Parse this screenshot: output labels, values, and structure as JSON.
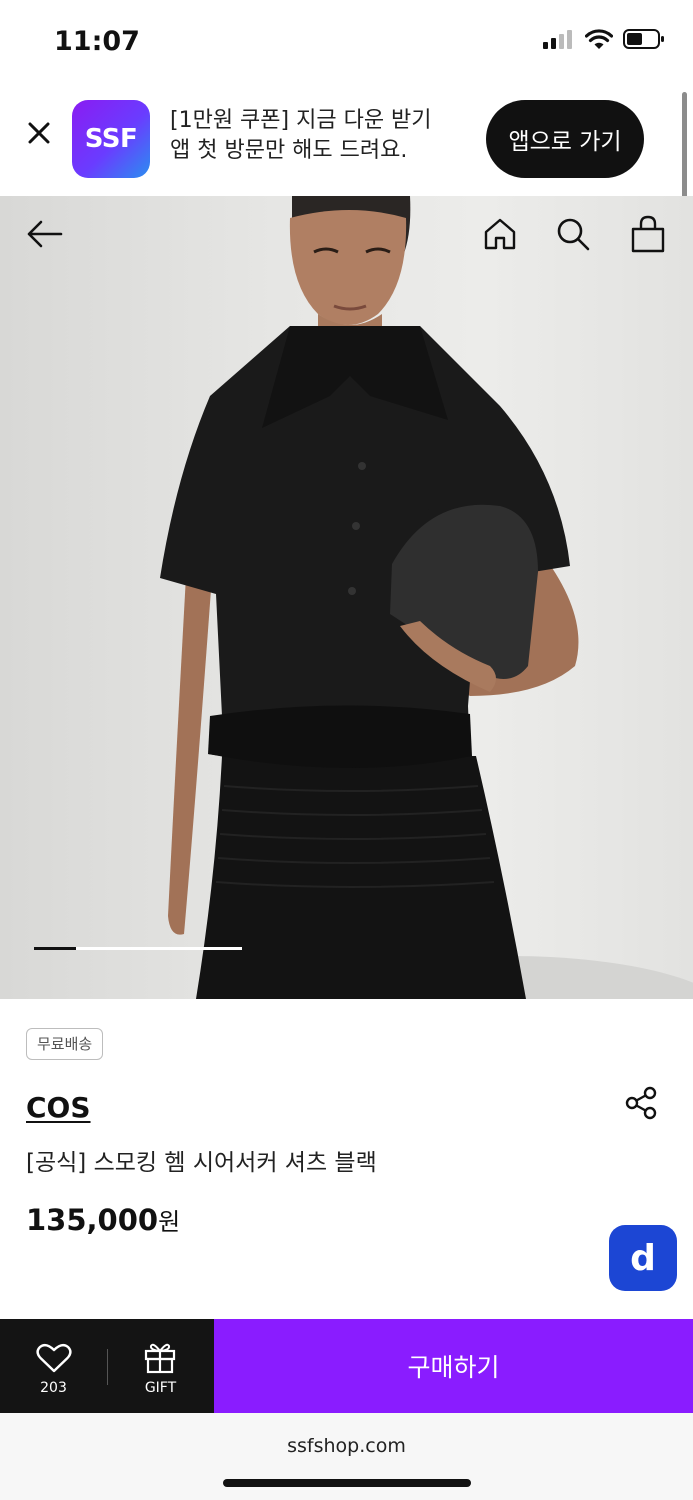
{
  "status_bar": {
    "time": "11:07"
  },
  "app_banner": {
    "logo_text": "SSF",
    "line1": "[1만원 쿠폰] 지금 다운 받기",
    "line2": "앱 첫 방문만 해도 드려요.",
    "cta_label": "앱으로 가기"
  },
  "hero": {
    "carousel_progress": 0.2
  },
  "product": {
    "shipping_badge": "무료배송",
    "brand": "COS",
    "name": "[공식] 스모킹 헴 시어서커 셔츠 블랙",
    "price": "135,000",
    "price_unit": "원",
    "fab_label": "d"
  },
  "bottom_bar": {
    "like_count": "203",
    "gift_label": "GIFT",
    "buy_label": "구매하기"
  },
  "browser": {
    "url": "ssfshop.com"
  },
  "colors": {
    "accent": "#8a1cff",
    "fab": "#1c46d4",
    "dark": "#141414"
  }
}
